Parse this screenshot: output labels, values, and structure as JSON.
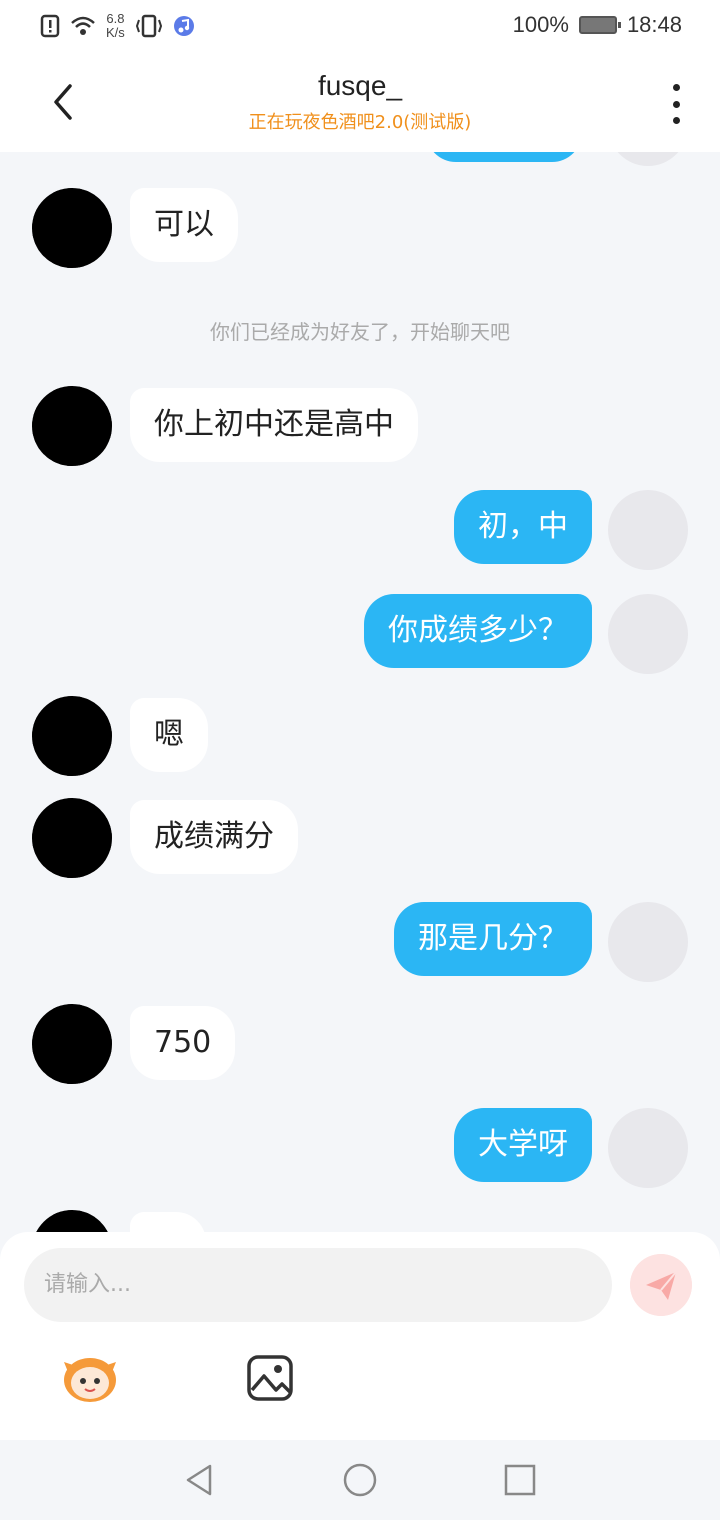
{
  "status_bar": {
    "network_speed_value": "6.8",
    "network_speed_unit": "K/s",
    "battery_percent": "100%",
    "time": "18:48"
  },
  "header": {
    "title": "fusqe_",
    "subtitle": "正在玩夜色酒吧2.0(测试版)"
  },
  "chat": {
    "system_notice": "你们已经成为好友了，开始聊天吧",
    "messages": [
      {
        "from": "other",
        "text": "可以"
      },
      {
        "from": "other",
        "text": "你上初中还是高中"
      },
      {
        "from": "me",
        "text": "初，中"
      },
      {
        "from": "me",
        "text": "你成绩多少？"
      },
      {
        "from": "other",
        "text": "嗯"
      },
      {
        "from": "other",
        "text": "成绩满分"
      },
      {
        "from": "me",
        "text": "那是几分？"
      },
      {
        "from": "other",
        "text": "750"
      },
      {
        "from": "me",
        "text": "大学呀"
      }
    ]
  },
  "input": {
    "placeholder": "请输入..."
  },
  "colors": {
    "accent_bubble": "#2bb6f4",
    "subtitle": "#f0901c",
    "send_button": "#fde2e1"
  },
  "icons": [
    "back-icon",
    "more-icon",
    "send-icon",
    "emoji-icon",
    "image-icon",
    "nav-back-icon",
    "nav-home-icon",
    "nav-recents-icon"
  ]
}
